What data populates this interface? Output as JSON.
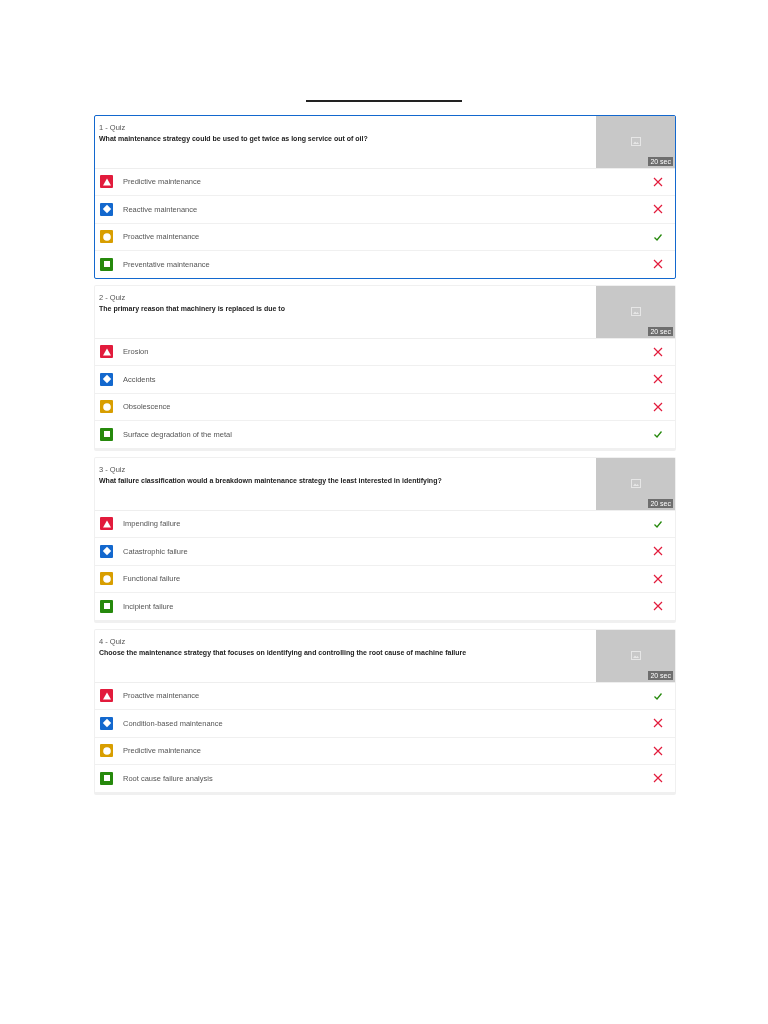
{
  "questions": [
    {
      "label": "1 - Quiz",
      "text": "What maintenance strategy could be used to get twice as long service out of oil?",
      "time": "20 sec",
      "selected": true,
      "answers": [
        {
          "kind": "triangle",
          "text": "Predictive maintenance",
          "correct": false
        },
        {
          "kind": "diamond",
          "text": "Reactive maintenance",
          "correct": false
        },
        {
          "kind": "circle",
          "text": "Proactive maintenance",
          "correct": true
        },
        {
          "kind": "square",
          "text": "Preventative maintenance",
          "correct": false
        }
      ]
    },
    {
      "label": "2 - Quiz",
      "text": "The primary reason that machinery is replaced is due to",
      "time": "20 sec",
      "selected": false,
      "answers": [
        {
          "kind": "triangle",
          "text": "Erosion",
          "correct": false
        },
        {
          "kind": "diamond",
          "text": "Accidents",
          "correct": false
        },
        {
          "kind": "circle",
          "text": "Obsolescence",
          "correct": false
        },
        {
          "kind": "square",
          "text": "Surface degradation of the metal",
          "correct": true
        }
      ]
    },
    {
      "label": "3 - Quiz",
      "text": "What failure classification would a breakdown maintenance strategy the least interested in identifying?",
      "time": "20 sec",
      "selected": false,
      "answers": [
        {
          "kind": "triangle",
          "text": "Impending failure",
          "correct": true
        },
        {
          "kind": "diamond",
          "text": "Catastrophic failure",
          "correct": false
        },
        {
          "kind": "circle",
          "text": "Functional failure",
          "correct": false
        },
        {
          "kind": "square",
          "text": "Incipient failure",
          "correct": false
        }
      ]
    },
    {
      "label": "4 - Quiz",
      "text": "Choose the maintenance strategy that focuses on identifying and controlling the root cause of machine failure",
      "time": "20 sec",
      "selected": false,
      "answers": [
        {
          "kind": "triangle",
          "text": "Proactive maintenance",
          "correct": true
        },
        {
          "kind": "diamond",
          "text": "Condition-based maintenance",
          "correct": false
        },
        {
          "kind": "circle",
          "text": "Predictive maintenance",
          "correct": false
        },
        {
          "kind": "square",
          "text": "Root cause failure analysis",
          "correct": false
        }
      ]
    }
  ]
}
